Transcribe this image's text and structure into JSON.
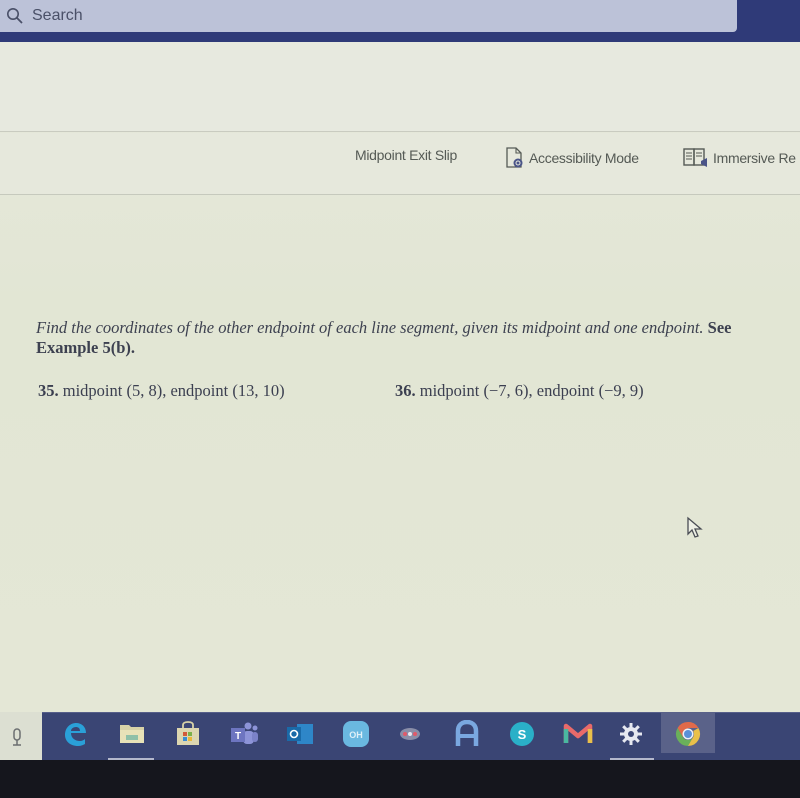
{
  "search": {
    "placeholder": "Search",
    "icon": "search-icon"
  },
  "command_bar": {
    "items": [
      {
        "label": "Midpoint Exit Slip",
        "icon": null
      },
      {
        "label": "Accessibility Mode",
        "icon": "accessibility-document-icon"
      },
      {
        "label": "Immersive Re",
        "icon": "immersive-reader-icon"
      }
    ]
  },
  "document": {
    "instructions_italic": "Find the coordinates of the other endpoint of each line segment, given its midpoint and one endpoint.",
    "instructions_reference": "See Example 5(b).",
    "problems": [
      {
        "number": "35.",
        "text": "midpoint (5, 8), endpoint (13, 10)"
      },
      {
        "number": "36.",
        "text": "midpoint (−7, 6), endpoint (−9, 9)"
      }
    ]
  },
  "taskbar": {
    "apps": [
      {
        "name": "Microsoft Edge",
        "icon": "edge-icon"
      },
      {
        "name": "File Explorer",
        "icon": "file-explorer-icon",
        "running": true
      },
      {
        "name": "Microsoft Store",
        "icon": "store-icon"
      },
      {
        "name": "Microsoft Teams",
        "icon": "teams-icon"
      },
      {
        "name": "Outlook",
        "icon": "outlook-icon"
      },
      {
        "name": "Office",
        "icon": "office-icon"
      },
      {
        "name": "Dots app",
        "icon": "dots-icon"
      },
      {
        "name": "A app",
        "icon": "a-app-icon"
      },
      {
        "name": "Skype",
        "icon": "skype-icon"
      },
      {
        "name": "Gmail",
        "icon": "gmail-icon"
      },
      {
        "name": "Settings",
        "icon": "settings-icon",
        "running": true
      },
      {
        "name": "Google Chrome",
        "icon": "chrome-icon",
        "active": true
      }
    ]
  },
  "colors": {
    "taskbar": "#3a4574",
    "topbar": "#2f3a78",
    "search_bg": "#bcc2d8",
    "page_bg": "#e4e6d8"
  }
}
